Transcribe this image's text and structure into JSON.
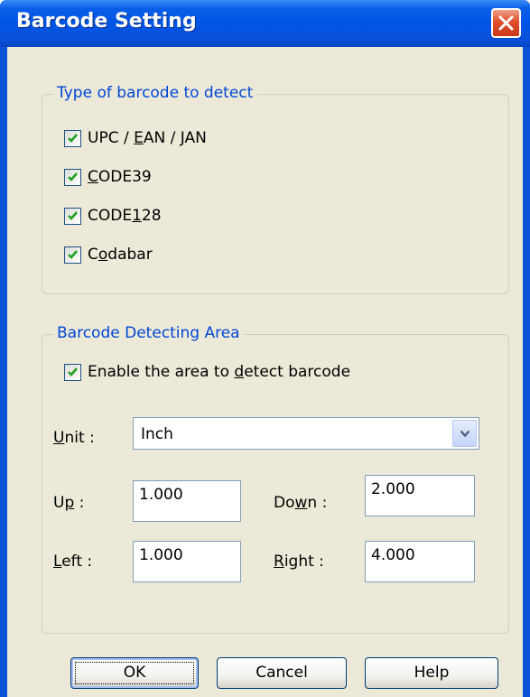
{
  "window": {
    "title": "Barcode Setting",
    "close_icon": "close-icon"
  },
  "type_group": {
    "title": "Type of barcode to detect",
    "items": [
      {
        "pre": "UPC / ",
        "u": "E",
        "post": "AN / JAN",
        "checked": true
      },
      {
        "pre": "",
        "u": "C",
        "post": "ODE39",
        "checked": true
      },
      {
        "pre": "CODE",
        "u": "1",
        "post": "28",
        "checked": true
      },
      {
        "pre": "C",
        "u": "o",
        "post": "dabar",
        "checked": true
      }
    ]
  },
  "area_group": {
    "title": "Barcode Detecting Area",
    "enable": {
      "pre": "Enable the area to ",
      "u": "d",
      "post": "etect barcode",
      "checked": true
    },
    "unit": {
      "u": "U",
      "post": "nit :",
      "value": "Inch"
    },
    "up": {
      "pre": "U",
      "u": "p",
      "post": " :",
      "value": "1.000"
    },
    "down": {
      "pre": "Do",
      "u": "w",
      "post": "n :",
      "value": "2.000"
    },
    "left": {
      "pre": "",
      "u": "L",
      "post": "eft :",
      "value": "1.000"
    },
    "right": {
      "pre": "",
      "u": "R",
      "post": "ight :",
      "value": "4.000"
    }
  },
  "buttons": {
    "ok": "OK",
    "cancel": "Cancel",
    "help": "Help"
  },
  "colors": {
    "titlebar": "#0055e5",
    "group_title": "#0046d5",
    "dialog_bg": "#ece9d8",
    "check": "#21a121"
  }
}
